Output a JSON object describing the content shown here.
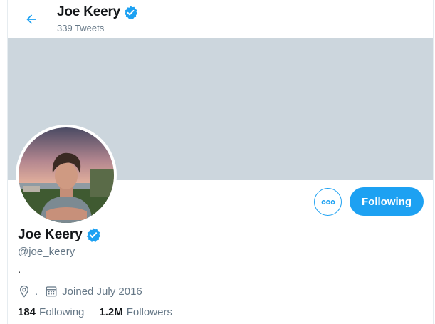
{
  "header": {
    "name": "Joe Keery",
    "tweet_count": "339 Tweets"
  },
  "actions": {
    "follow_label": "Following"
  },
  "profile": {
    "name": "Joe Keery",
    "handle": "@joe_keery",
    "bio": ".",
    "location": ".",
    "joined": "Joined July 2016",
    "verified": true
  },
  "stats": [
    {
      "value": "184",
      "label": "Following"
    },
    {
      "value": "1.2M",
      "label": "Followers"
    }
  ],
  "colors": {
    "accent": "#1da1f2",
    "banner": "#ccd6dd",
    "secondary_text": "#657786"
  },
  "icons": {
    "back": "arrow-left-icon",
    "verified": "verified-badge-icon",
    "more": "more-dots-icon",
    "location": "location-pin-icon",
    "calendar": "calendar-icon"
  }
}
